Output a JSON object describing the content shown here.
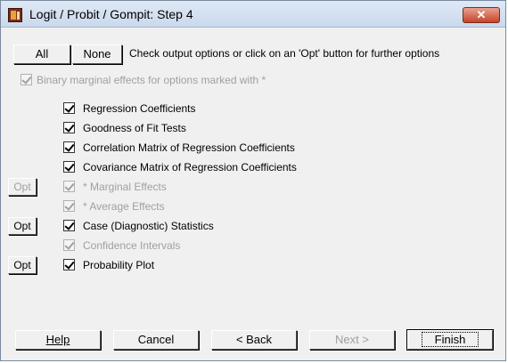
{
  "window": {
    "title": "Logit / Probit / Gompit: Step 4",
    "close_label": "✕"
  },
  "top": {
    "all_label": "All",
    "none_label": "None",
    "instruction": "Check output options or click on an 'Opt' button for further options"
  },
  "binary_option": {
    "label": "Binary marginal effects for options marked with *",
    "checked": true,
    "enabled": false
  },
  "options": [
    {
      "label": "Regression Coefficients",
      "checked": true,
      "enabled": true,
      "opt": ""
    },
    {
      "label": "Goodness of Fit Tests",
      "checked": true,
      "enabled": true,
      "opt": ""
    },
    {
      "label": "Correlation Matrix of Regression Coefficients",
      "checked": true,
      "enabled": true,
      "opt": ""
    },
    {
      "label": "Covariance Matrix of Regression Coefficients",
      "checked": true,
      "enabled": true,
      "opt": ""
    },
    {
      "label": "* Marginal Effects",
      "checked": true,
      "enabled": false,
      "opt": "Opt"
    },
    {
      "label": "* Average Effects",
      "checked": true,
      "enabled": false,
      "opt": ""
    },
    {
      "label": "Case (Diagnostic) Statistics",
      "checked": true,
      "enabled": true,
      "opt": "Opt"
    },
    {
      "label": "Confidence Intervals",
      "checked": true,
      "enabled": false,
      "opt": ""
    },
    {
      "label": "Probability Plot",
      "checked": true,
      "enabled": true,
      "opt": "Opt"
    }
  ],
  "bottom": {
    "help_label": "Help",
    "cancel_label": "Cancel",
    "back_label": "< Back",
    "next_label": "Next >",
    "finish_label": "Finish"
  }
}
